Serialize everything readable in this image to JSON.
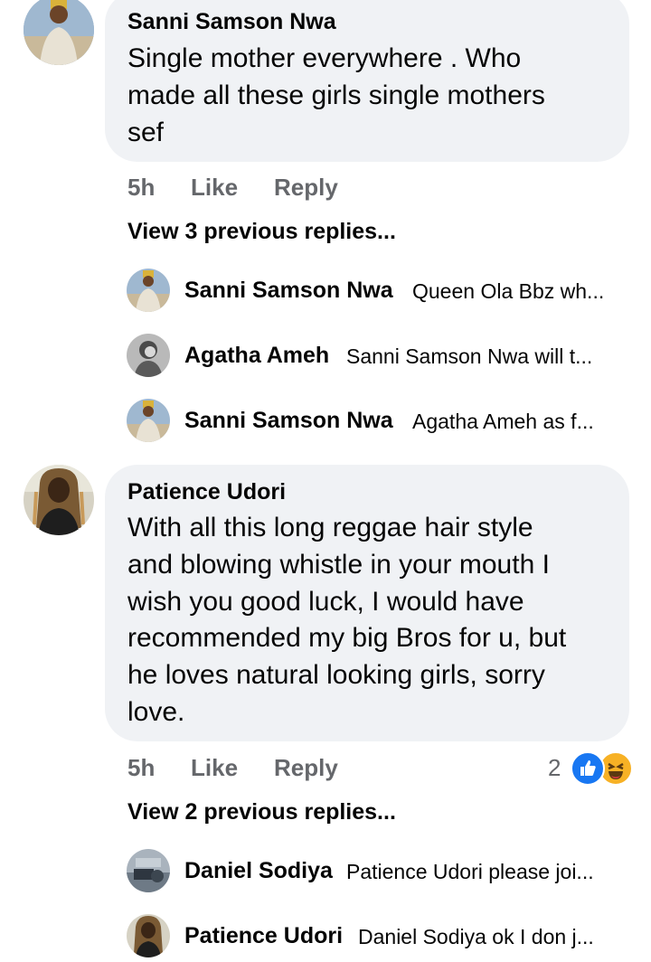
{
  "comments": [
    {
      "author": "Sanni Samson Nwa",
      "text_lines": [
        "Single mother everywhere . Who",
        "made all these girls single mothers",
        "sef"
      ],
      "time": "5h",
      "like_label": "Like",
      "reply_label": "Reply",
      "view_replies": "View 3 previous replies...",
      "replies": [
        {
          "name": "Sanni Samson Nwa",
          "text": "Queen Ola Bbz wh..."
        },
        {
          "name": "Agatha Ameh",
          "text": "Sanni Samson Nwa will t..."
        },
        {
          "name": "Sanni Samson Nwa",
          "text": "Agatha Ameh as f..."
        }
      ]
    },
    {
      "author": "Patience Udori",
      "text_lines": [
        "With all this long reggae hair style",
        "and blowing whistle in your mouth I",
        "wish you good luck, I would have",
        "recommended my big Bros for u, but",
        "he loves natural looking girls, sorry",
        "love."
      ],
      "time": "5h",
      "like_label": "Like",
      "reply_label": "Reply",
      "reaction_count": "2",
      "reactions": [
        "like-reaction",
        "haha-reaction"
      ],
      "view_replies": "View 2 previous replies...",
      "replies": [
        {
          "name": "Daniel Sodiya",
          "text": "Patience Udori please joi..."
        },
        {
          "name": "Patience Udori",
          "text": "Daniel Sodiya ok I don j..."
        }
      ]
    }
  ],
  "colors": {
    "bubble": "#f0f2f5",
    "meta_text": "#65676b",
    "like_blue": "#1877f2",
    "haha_yellow": "#f7b125"
  }
}
